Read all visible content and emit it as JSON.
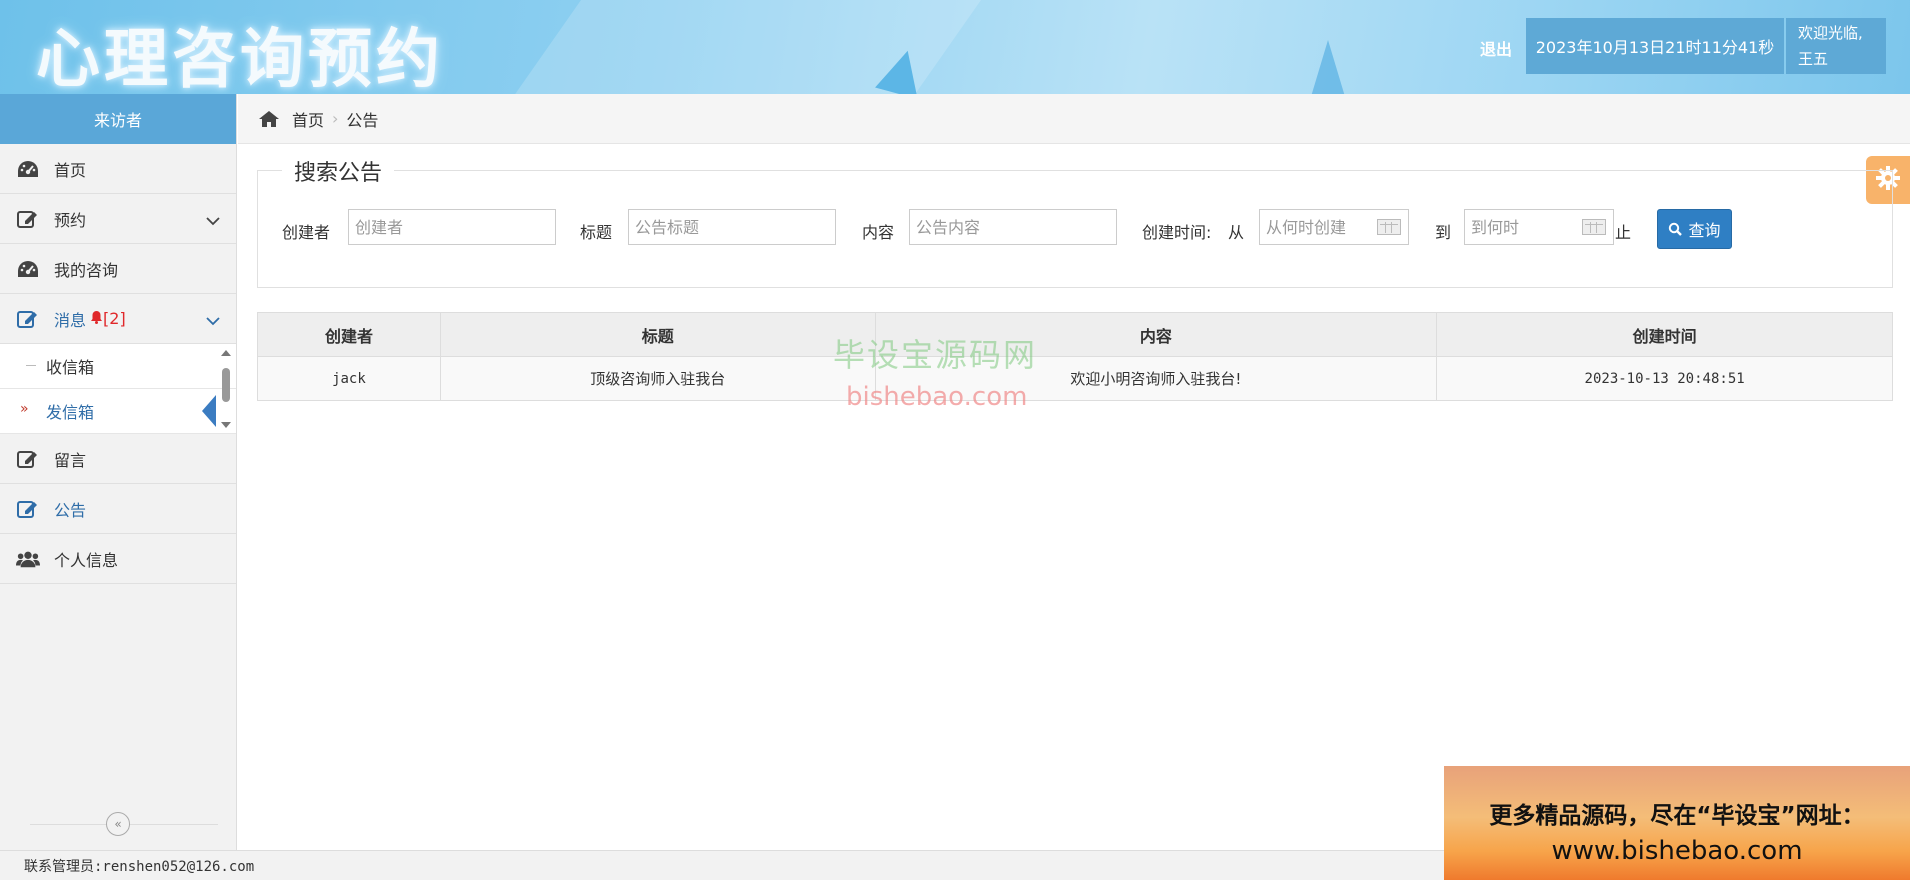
{
  "header": {
    "logo_text": "心理咨询预约",
    "logout_label": "退出",
    "datetime": "2023年10月13日21时11分41秒",
    "welcome": "欢迎光临,",
    "username": "王五"
  },
  "sidebar": {
    "title": "来访者",
    "items": [
      {
        "label": "首页",
        "icon": "dashboard-icon"
      },
      {
        "label": "预约",
        "icon": "edit-icon"
      },
      {
        "label": "我的咨询",
        "icon": "dashboard-icon"
      },
      {
        "label": "消息",
        "icon": "edit-icon",
        "badge": "[2]"
      },
      {
        "label": "留言",
        "icon": "edit-icon"
      },
      {
        "label": "公告",
        "icon": "edit-icon"
      },
      {
        "label": "个人信息",
        "icon": "users-icon"
      }
    ],
    "sub_items": [
      {
        "label": "收信箱"
      },
      {
        "label": "发信箱"
      }
    ],
    "collapse_symbol": "«"
  },
  "breadcrumb": {
    "home": "首页",
    "current": "公告"
  },
  "search": {
    "legend": "搜索公告",
    "creator_label": "创建者",
    "creator_placeholder": "创建者",
    "title_label": "标题",
    "title_placeholder": "公告标题",
    "content_label": "内容",
    "content_placeholder": "公告内容",
    "created_time_label": "创建时间:",
    "from_label": "从",
    "from_placeholder": "从何时创建",
    "to_label": "到",
    "to_placeholder": "到何时",
    "until_label": "止",
    "query_label": "查询"
  },
  "table": {
    "headers": [
      "创建者",
      "标题",
      "内容",
      "创建时间"
    ],
    "rows": [
      [
        "jack",
        "顶级咨询师入驻我台",
        "欢迎小明咨询师入驻我台!",
        "2023-10-13 20:48:51"
      ]
    ]
  },
  "watermark": {
    "cn": "毕设宝源码网",
    "en": "bishebao.com"
  },
  "footer": {
    "contact": "联系管理员:renshen052@126.com"
  },
  "ad": {
    "line1": "更多精品源码，尽在“毕设宝”网址：",
    "line2": "www.bishebao.com"
  },
  "colors": {
    "accent": "#2f7fc4",
    "sidebar_header": "#5aa7d8",
    "badge": "#e0282a",
    "settings_tab": "#f8b36a"
  }
}
